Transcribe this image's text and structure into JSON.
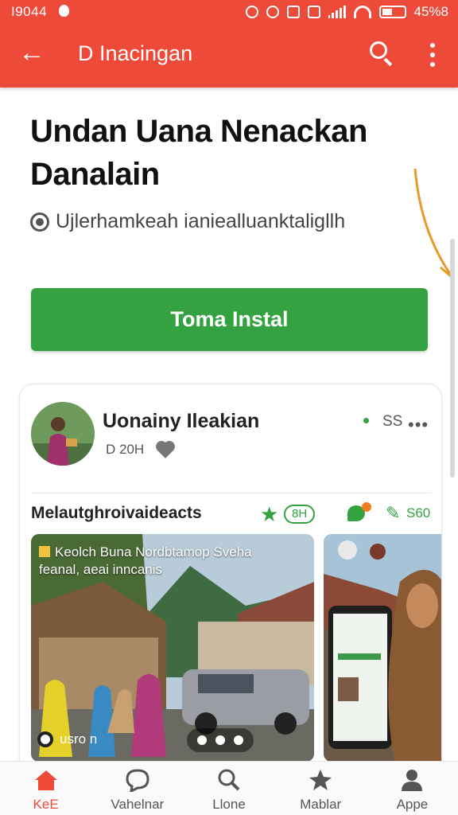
{
  "status_bar": {
    "time": "I9044",
    "right_text": "45%8"
  },
  "app_bar": {
    "back_label": "←",
    "title": "D Inacingan"
  },
  "headline": "Undan Uana Nenackan Danalain",
  "subline": "Ujlerhamkeah ianiealluanktaligllh",
  "install_button_label": "Toma Instal",
  "card": {
    "author_name": "Uonainy Ileakian",
    "author_meta": "D 20H",
    "count": "SS",
    "more": "•••",
    "section_title": "Melautghroivaideacts",
    "pill": "8H",
    "edit_count": "S60",
    "photo_caption_line1": "Keolch Buna Nordbtamop Sveha",
    "photo_caption_line2": "feanal, aeai inncanis",
    "photo_user": "usro n"
  },
  "bottom_nav": [
    {
      "label": "KeE",
      "icon": "home-icon",
      "active": true
    },
    {
      "label": "Vahelnar",
      "icon": "chat-bubble-icon",
      "active": false
    },
    {
      "label": "Llone",
      "icon": "search-icon",
      "active": false
    },
    {
      "label": "Mablar",
      "icon": "star-icon",
      "active": false
    },
    {
      "label": "Appe",
      "icon": "person-icon",
      "active": false
    }
  ],
  "colors": {
    "brand": "#ee4a3a",
    "accent": "#34a241",
    "annotation": "#e89a2a"
  }
}
